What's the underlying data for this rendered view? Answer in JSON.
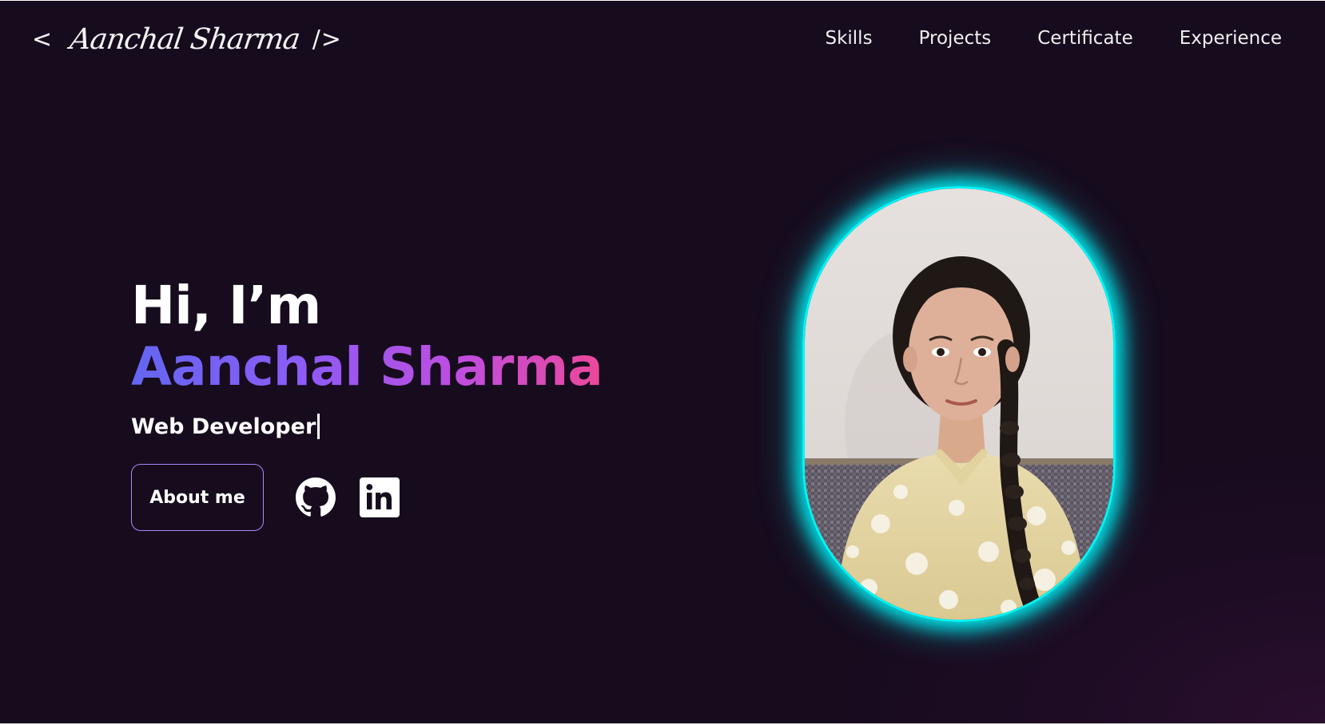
{
  "header": {
    "logo_open": "<",
    "logo_name": "Aanchal Sharma",
    "logo_close": "/>",
    "nav": [
      {
        "label": "Skills"
      },
      {
        "label": "Projects"
      },
      {
        "label": "Certificate"
      },
      {
        "label": "Experience"
      }
    ]
  },
  "hero": {
    "greeting": "Hi, I’m",
    "name": "Aanchal Sharma",
    "role": "Web Developer",
    "about_button": "About me"
  },
  "colors": {
    "background": "#170b1e",
    "name_gradient_start": "#6366f1",
    "name_gradient_end": "#ec4899",
    "portrait_glow": "#00f5f5",
    "button_border": "#a78bfa"
  },
  "icons": {
    "github": "github-icon",
    "linkedin": "linkedin-icon"
  }
}
